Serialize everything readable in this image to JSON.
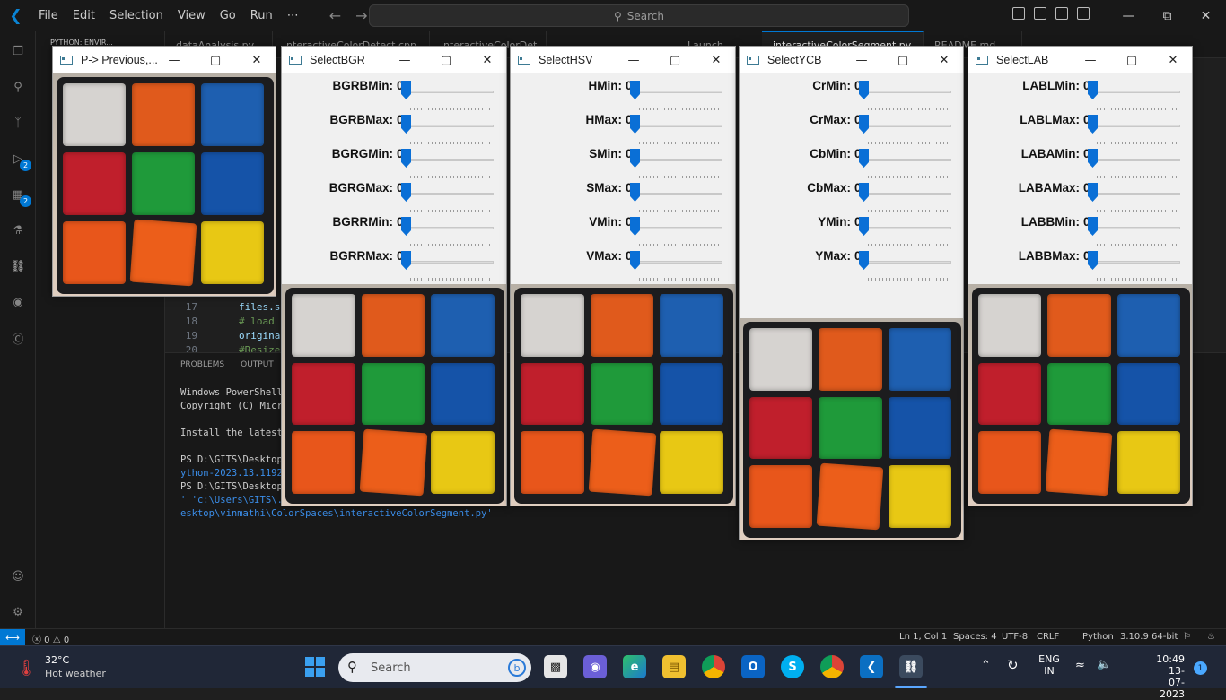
{
  "titlebar": {
    "menu": [
      "File",
      "Edit",
      "Selection",
      "View",
      "Go",
      "Run",
      "⋯"
    ],
    "search_placeholder": "Search"
  },
  "sidebar": {
    "header": "PYTHON: ENVIR..."
  },
  "tabs": [
    {
      "label": "dataAnalysis.py"
    },
    {
      "label": "interactiveColorDetect.cpp"
    },
    {
      "label": "interactiveColorDet..."
    },
    {
      "label": "Launch"
    },
    {
      "label": "interactiveColorSegment.py"
    },
    {
      "label": "README.md"
    }
  ],
  "editor": {
    "lines": [
      {
        "no": "17",
        "code": "files.s",
        "color": "#9cdcfe"
      },
      {
        "no": "18",
        "code": "# load",
        "color": "#6a9955"
      },
      {
        "no": "19",
        "code": "origina",
        "color": "#9cdcfe"
      },
      {
        "no": "20",
        "code": "#Resize",
        "color": "#6a9955"
      }
    ]
  },
  "panel": {
    "tabs": [
      "PROBLEMS",
      "OUTPUT"
    ],
    "terminal": [
      {
        "text": "Windows PowerShell",
        "blue": false
      },
      {
        "text": "Copyright (C) Micro",
        "blue": false
      },
      {
        "text": "",
        "blue": false
      },
      {
        "text": "Install the latest",
        "blue": false
      },
      {
        "text": "",
        "blue": false
      },
      {
        "text": "PS D:\\GITS\\Desktop\\",
        "blue": false
      },
      {
        "text": "ython-2023.13.11921",
        "blue": true
      },
      {
        "text": "PS D:\\GITS\\Desktop\\",
        "blue": false
      },
      {
        "text": "' 'c:\\Users\\GITS\\.v",
        "blue": true
      },
      {
        "text": "esktop\\vinmathi\\ColorSpaces\\interactiveColorSegment.py'",
        "blue": true
      }
    ]
  },
  "statusbar": {
    "problems": "ⓧ 0 ⚠ 0",
    "position": "Ln 1, Col 1",
    "spaces": "Spaces: 4",
    "encoding": "UTF-8",
    "eol": "CRLF",
    "language": "Python",
    "interpreter": "3.10.9 64-bit"
  },
  "windows": [
    {
      "title": "P-> Previous,...",
      "sliders": []
    },
    {
      "title": "SelectBGR",
      "sliders": [
        {
          "label": "BGRBMin:",
          "value": "0"
        },
        {
          "label": "BGRBMax:",
          "value": "0"
        },
        {
          "label": "BGRGMin:",
          "value": "0"
        },
        {
          "label": "BGRGMax:",
          "value": "0"
        },
        {
          "label": "BGRRMin:",
          "value": "0"
        },
        {
          "label": "BGRRMax:",
          "value": "0"
        }
      ]
    },
    {
      "title": "SelectHSV",
      "sliders": [
        {
          "label": "HMin:",
          "value": "0"
        },
        {
          "label": "HMax:",
          "value": "0"
        },
        {
          "label": "SMin:",
          "value": "0"
        },
        {
          "label": "SMax:",
          "value": "0"
        },
        {
          "label": "VMin:",
          "value": "0"
        },
        {
          "label": "VMax:",
          "value": "0"
        }
      ]
    },
    {
      "title": "SelectYCB",
      "sliders": [
        {
          "label": "CrMin:",
          "value": "0"
        },
        {
          "label": "CrMax:",
          "value": "0"
        },
        {
          "label": "CbMin:",
          "value": "0"
        },
        {
          "label": "CbMax:",
          "value": "0"
        },
        {
          "label": "YMin:",
          "value": "0"
        },
        {
          "label": "YMax:",
          "value": "0"
        }
      ]
    },
    {
      "title": "SelectLAB",
      "sliders": [
        {
          "label": "LABLMin:",
          "value": "0"
        },
        {
          "label": "LABLMax:",
          "value": "0"
        },
        {
          "label": "LABAMin:",
          "value": "0"
        },
        {
          "label": "LABAMax:",
          "value": "0"
        },
        {
          "label": "LABBMin:",
          "value": "0"
        },
        {
          "label": "LABBMax:",
          "value": "0"
        }
      ]
    }
  ],
  "cube_colors": [
    "#d6d3d0",
    "#e05a1c",
    "#1e5fb0",
    "#c01f2c",
    "#1f9a3a",
    "#1553a8",
    "#e8561b",
    "#ec5e1a",
    "#e8c814"
  ],
  "taskbar": {
    "weather_temp": "32°C",
    "weather_desc": "Hot weather",
    "search_placeholder": "Search",
    "lang_top": "ENG",
    "lang_bottom": "IN",
    "time": "10:49",
    "date": "13-07-2023",
    "notification_count": "1"
  }
}
